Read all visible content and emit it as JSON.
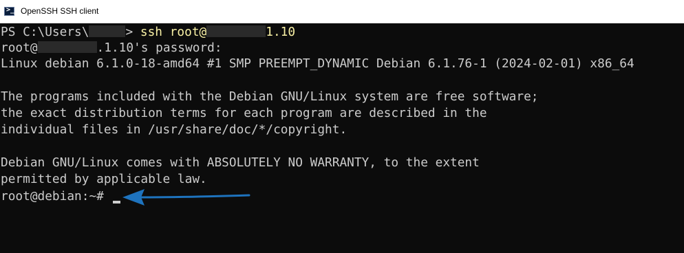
{
  "window": {
    "title": "OpenSSH SSH client",
    "icon": "terminal-icon"
  },
  "terminal": {
    "prompt_prefix": "PS C:\\Users\\",
    "prompt_suffix": "> ",
    "command": "ssh root@",
    "command_tail": "1.10",
    "password_prefix": "root@",
    "password_suffix": ".1.10's password:",
    "lines": [
      "Linux debian 6.1.0-18-amd64 #1 SMP PREEMPT_DYNAMIC Debian 6.1.76-1 (2024-02-01) x86_64",
      "",
      "The programs included with the Debian GNU/Linux system are free software;",
      "the exact distribution terms for each program are described in the",
      "individual files in /usr/share/doc/*/copyright.",
      "",
      "Debian GNU/Linux comes with ABSOLUTELY NO WARRANTY, to the extent",
      "permitted by applicable law."
    ],
    "final_prompt": "root@debian:~#"
  },
  "colors": {
    "terminal_bg": "#0c0c0c",
    "text": "#cccccc",
    "command": "#f9f1a5",
    "arrow": "#1e73be"
  }
}
